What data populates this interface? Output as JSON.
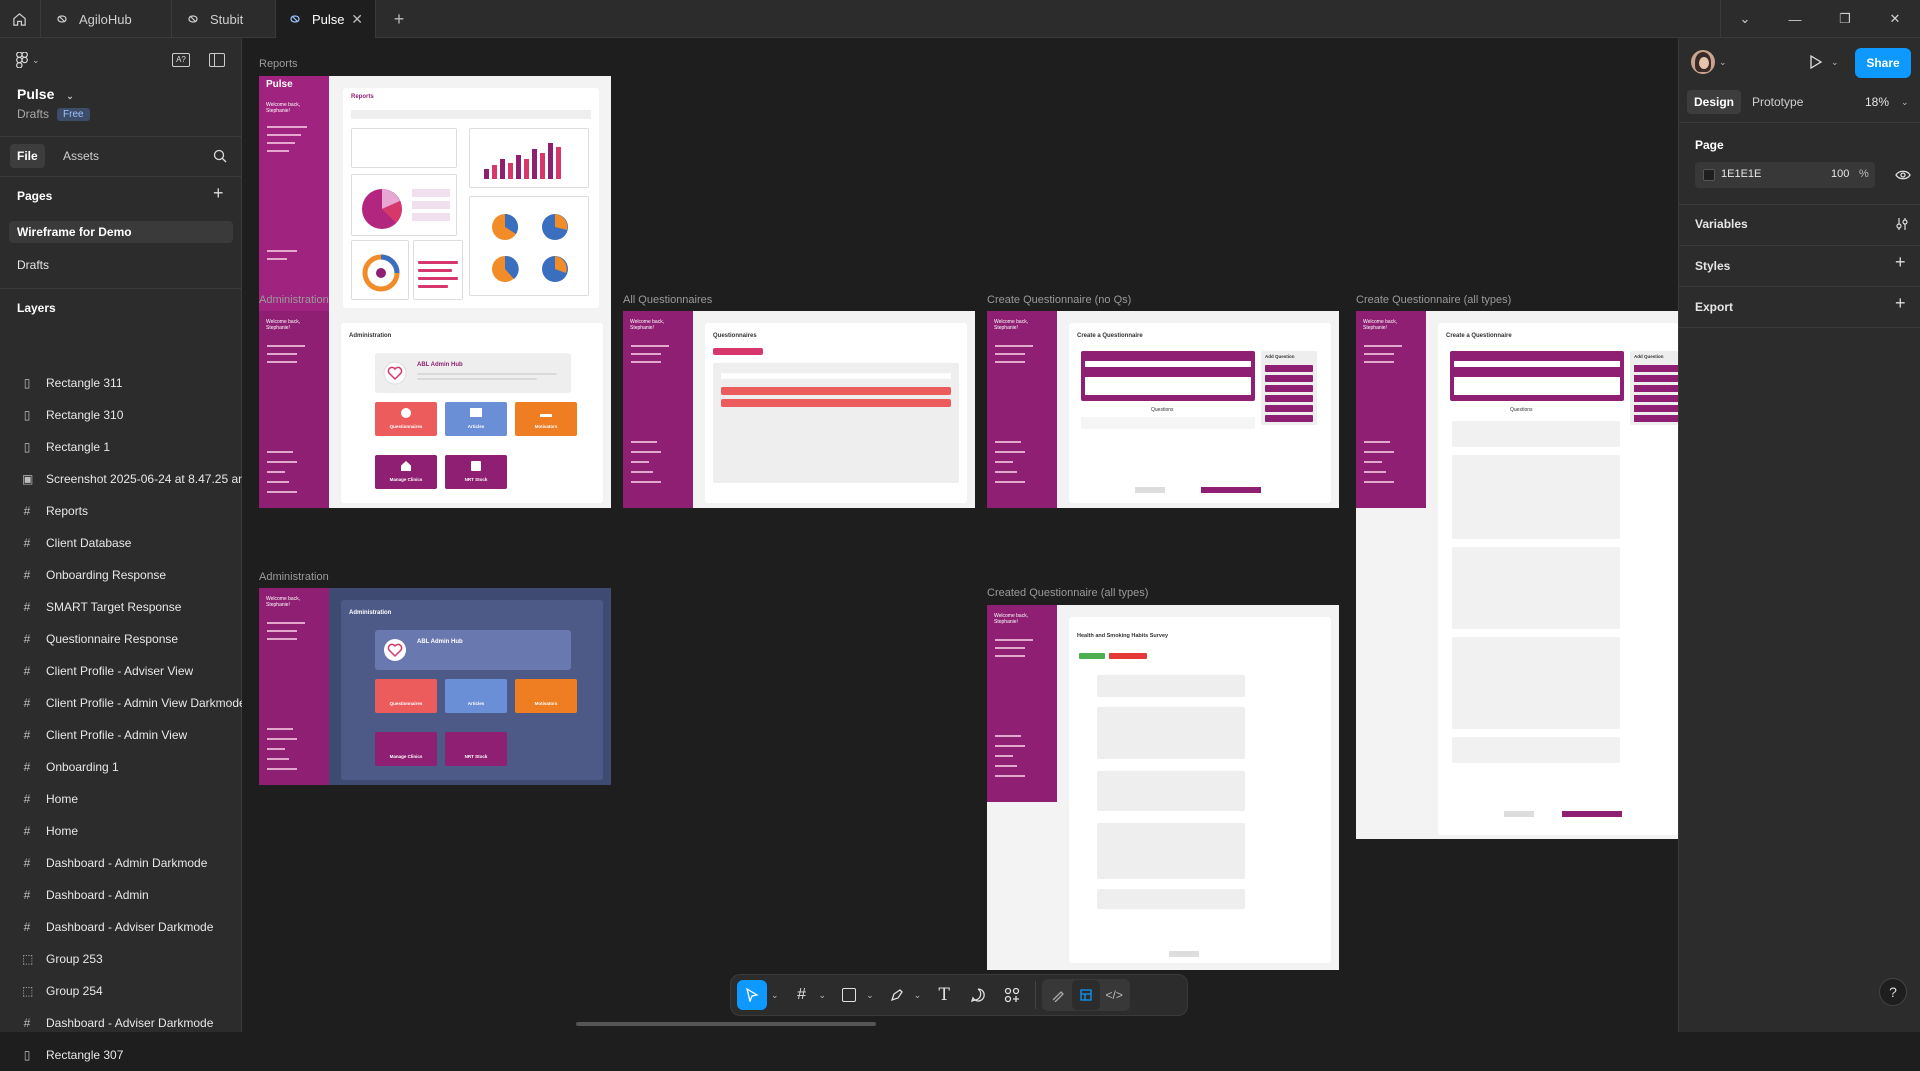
{
  "tabs": [
    {
      "label": "AgiloHub"
    },
    {
      "label": "Stubit"
    },
    {
      "label": "Pulse",
      "active": true
    }
  ],
  "file": {
    "name": "Pulse",
    "location": "Drafts",
    "plan": "Free"
  },
  "left_tabs": {
    "file": "File",
    "assets": "Assets"
  },
  "pages": {
    "title": "Pages",
    "items": [
      "Wireframe for Demo",
      "Drafts"
    ]
  },
  "layers": {
    "title": "Layers",
    "items": [
      {
        "name": "Rectangle 311",
        "icon": "rectangle-icon"
      },
      {
        "name": "Rectangle 310",
        "icon": "rectangle-icon"
      },
      {
        "name": "Rectangle 1",
        "icon": "rectangle-icon"
      },
      {
        "name": "Screenshot 2025-06-24 at 8.47.25 am",
        "icon": "image-icon"
      },
      {
        "name": "Reports",
        "icon": "frame-icon"
      },
      {
        "name": "Client Database",
        "icon": "frame-icon"
      },
      {
        "name": "Onboarding Response",
        "icon": "frame-icon"
      },
      {
        "name": "SMART Target Response",
        "icon": "frame-icon"
      },
      {
        "name": "Questionnaire Response",
        "icon": "frame-icon"
      },
      {
        "name": "Client Profile - Adviser View",
        "icon": "frame-icon"
      },
      {
        "name": "Client Profile - Admin View Darkmode",
        "icon": "frame-icon"
      },
      {
        "name": "Client Profile - Admin View",
        "icon": "frame-icon"
      },
      {
        "name": "Onboarding 1",
        "icon": "frame-icon"
      },
      {
        "name": "Home",
        "icon": "frame-icon"
      },
      {
        "name": "Home",
        "icon": "frame-icon"
      },
      {
        "name": "Dashboard - Admin Darkmode",
        "icon": "frame-icon"
      },
      {
        "name": "Dashboard - Admin",
        "icon": "frame-icon"
      },
      {
        "name": "Dashboard - Adviser Darkmode",
        "icon": "frame-icon"
      },
      {
        "name": "Group 253",
        "icon": "group-icon"
      },
      {
        "name": "Group 254",
        "icon": "group-icon"
      },
      {
        "name": "Dashboard - Adviser Darkmode",
        "icon": "frame-icon"
      },
      {
        "name": "Rectangle 307",
        "icon": "rectangle-icon"
      }
    ]
  },
  "right": {
    "share": "Share",
    "tabs": [
      "Design",
      "Prototype"
    ],
    "zoom": "18%",
    "page_title": "Page",
    "page_color": "1E1E1E",
    "page_opacity": "100",
    "percent": "%",
    "variables": "Variables",
    "styles": "Styles",
    "export": "Export"
  },
  "canvas": {
    "frame_labels": {
      "reports": "Reports",
      "admin1": "Administration",
      "allq": "All Questionnaires",
      "createnoq": "Create Questionnaire (no Qs)",
      "createall": "Create Questionnaire (all types)",
      "admin2": "Administration",
      "created": "Created Questionnaire (all types)"
    },
    "app": {
      "welcome": "Welcome back, Stephanie!",
      "brand": "Pulse",
      "reports_title": "Reports",
      "admin_title": "Administration",
      "hub_title": "ABL Admin Hub",
      "questionnaires": "Questionnaires",
      "articles": "Articles",
      "motivators": "Motivators",
      "manage_clinics": "Manage Clinics",
      "nrt_stock": "NRT Stock",
      "allq_title": "Questionnaires",
      "create_title": "Create a Questionnaire",
      "questions": "Questions",
      "add_question": "Add Question",
      "survey_title": "Health and Smoking Habits Survey"
    }
  },
  "colors": {
    "accent": "#0d99ff",
    "brand": "#8e1f72",
    "canvas": "#1e1e1e",
    "panel": "#2c2c2c"
  }
}
